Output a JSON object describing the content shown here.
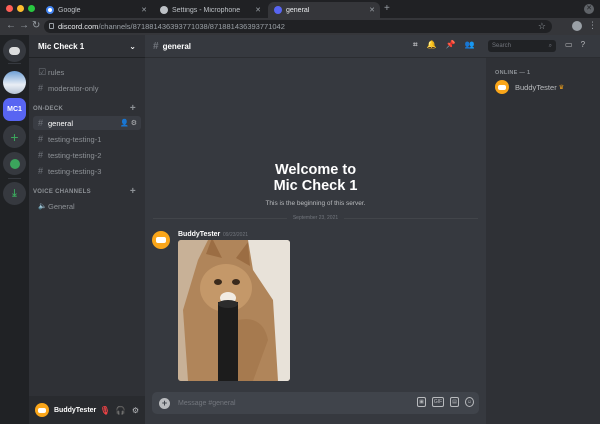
{
  "browser": {
    "tabs": [
      {
        "title": "Google",
        "active": false
      },
      {
        "title": "Settings - Microphone",
        "active": false
      },
      {
        "title": "general",
        "active": true
      }
    ],
    "url_host": "discord.com",
    "url_path": "/channels/871881436393771038/871881436393771042"
  },
  "server": {
    "name": "Mic Check 1",
    "icon_label": "MC1"
  },
  "channels": {
    "top": [
      "rules",
      "moderator-only"
    ],
    "on_deck_label": "ON-DECK",
    "on_deck": [
      "general",
      "testing-testing-1",
      "testing-testing-2",
      "testing-testing-3"
    ],
    "voice_label": "VOICE CHANNELS",
    "voice": [
      "General"
    ]
  },
  "user_panel": {
    "username": "BuddyTester"
  },
  "main": {
    "channel_name": "general",
    "welcome_line1": "Welcome to",
    "welcome_line2": "Mic Check 1",
    "welcome_sub": "This is the beginning of this server.",
    "date_divider": "September 23, 2021",
    "message": {
      "author": "BuddyTester",
      "timestamp": "09/23/2021"
    },
    "input_placeholder": "Message #general",
    "input_icons": [
      "gift-icon",
      "gif-icon",
      "sticker-icon",
      "emoji-icon"
    ]
  },
  "members": {
    "search_placeholder": "Search",
    "online_label": "ONLINE — 1",
    "list": [
      {
        "name": "BuddyTester",
        "owner": true
      }
    ]
  },
  "colors": {
    "blurple": "#5865f2",
    "green": "#3ba55c",
    "avatar_orange": "#faa61a"
  }
}
